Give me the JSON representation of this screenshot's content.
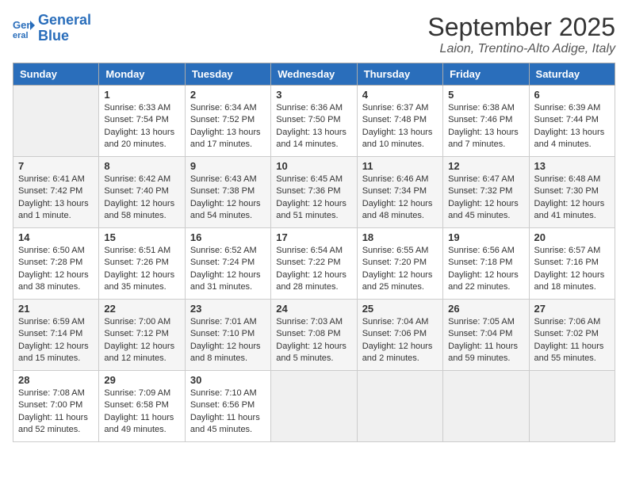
{
  "header": {
    "logo_line1": "General",
    "logo_line2": "Blue",
    "title": "September 2025",
    "subtitle": "Laion, Trentino-Alto Adige, Italy"
  },
  "days_of_week": [
    "Sunday",
    "Monday",
    "Tuesday",
    "Wednesday",
    "Thursday",
    "Friday",
    "Saturday"
  ],
  "weeks": [
    [
      {
        "day": "",
        "sunrise": "",
        "sunset": "",
        "daylight": "",
        "empty": true
      },
      {
        "day": "1",
        "sunrise": "Sunrise: 6:33 AM",
        "sunset": "Sunset: 7:54 PM",
        "daylight": "Daylight: 13 hours and 20 minutes."
      },
      {
        "day": "2",
        "sunrise": "Sunrise: 6:34 AM",
        "sunset": "Sunset: 7:52 PM",
        "daylight": "Daylight: 13 hours and 17 minutes."
      },
      {
        "day": "3",
        "sunrise": "Sunrise: 6:36 AM",
        "sunset": "Sunset: 7:50 PM",
        "daylight": "Daylight: 13 hours and 14 minutes."
      },
      {
        "day": "4",
        "sunrise": "Sunrise: 6:37 AM",
        "sunset": "Sunset: 7:48 PM",
        "daylight": "Daylight: 13 hours and 10 minutes."
      },
      {
        "day": "5",
        "sunrise": "Sunrise: 6:38 AM",
        "sunset": "Sunset: 7:46 PM",
        "daylight": "Daylight: 13 hours and 7 minutes."
      },
      {
        "day": "6",
        "sunrise": "Sunrise: 6:39 AM",
        "sunset": "Sunset: 7:44 PM",
        "daylight": "Daylight: 13 hours and 4 minutes."
      }
    ],
    [
      {
        "day": "7",
        "sunrise": "Sunrise: 6:41 AM",
        "sunset": "Sunset: 7:42 PM",
        "daylight": "Daylight: 13 hours and 1 minute."
      },
      {
        "day": "8",
        "sunrise": "Sunrise: 6:42 AM",
        "sunset": "Sunset: 7:40 PM",
        "daylight": "Daylight: 12 hours and 58 minutes."
      },
      {
        "day": "9",
        "sunrise": "Sunrise: 6:43 AM",
        "sunset": "Sunset: 7:38 PM",
        "daylight": "Daylight: 12 hours and 54 minutes."
      },
      {
        "day": "10",
        "sunrise": "Sunrise: 6:45 AM",
        "sunset": "Sunset: 7:36 PM",
        "daylight": "Daylight: 12 hours and 51 minutes."
      },
      {
        "day": "11",
        "sunrise": "Sunrise: 6:46 AM",
        "sunset": "Sunset: 7:34 PM",
        "daylight": "Daylight: 12 hours and 48 minutes."
      },
      {
        "day": "12",
        "sunrise": "Sunrise: 6:47 AM",
        "sunset": "Sunset: 7:32 PM",
        "daylight": "Daylight: 12 hours and 45 minutes."
      },
      {
        "day": "13",
        "sunrise": "Sunrise: 6:48 AM",
        "sunset": "Sunset: 7:30 PM",
        "daylight": "Daylight: 12 hours and 41 minutes."
      }
    ],
    [
      {
        "day": "14",
        "sunrise": "Sunrise: 6:50 AM",
        "sunset": "Sunset: 7:28 PM",
        "daylight": "Daylight: 12 hours and 38 minutes."
      },
      {
        "day": "15",
        "sunrise": "Sunrise: 6:51 AM",
        "sunset": "Sunset: 7:26 PM",
        "daylight": "Daylight: 12 hours and 35 minutes."
      },
      {
        "day": "16",
        "sunrise": "Sunrise: 6:52 AM",
        "sunset": "Sunset: 7:24 PM",
        "daylight": "Daylight: 12 hours and 31 minutes."
      },
      {
        "day": "17",
        "sunrise": "Sunrise: 6:54 AM",
        "sunset": "Sunset: 7:22 PM",
        "daylight": "Daylight: 12 hours and 28 minutes."
      },
      {
        "day": "18",
        "sunrise": "Sunrise: 6:55 AM",
        "sunset": "Sunset: 7:20 PM",
        "daylight": "Daylight: 12 hours and 25 minutes."
      },
      {
        "day": "19",
        "sunrise": "Sunrise: 6:56 AM",
        "sunset": "Sunset: 7:18 PM",
        "daylight": "Daylight: 12 hours and 22 minutes."
      },
      {
        "day": "20",
        "sunrise": "Sunrise: 6:57 AM",
        "sunset": "Sunset: 7:16 PM",
        "daylight": "Daylight: 12 hours and 18 minutes."
      }
    ],
    [
      {
        "day": "21",
        "sunrise": "Sunrise: 6:59 AM",
        "sunset": "Sunset: 7:14 PM",
        "daylight": "Daylight: 12 hours and 15 minutes."
      },
      {
        "day": "22",
        "sunrise": "Sunrise: 7:00 AM",
        "sunset": "Sunset: 7:12 PM",
        "daylight": "Daylight: 12 hours and 12 minutes."
      },
      {
        "day": "23",
        "sunrise": "Sunrise: 7:01 AM",
        "sunset": "Sunset: 7:10 PM",
        "daylight": "Daylight: 12 hours and 8 minutes."
      },
      {
        "day": "24",
        "sunrise": "Sunrise: 7:03 AM",
        "sunset": "Sunset: 7:08 PM",
        "daylight": "Daylight: 12 hours and 5 minutes."
      },
      {
        "day": "25",
        "sunrise": "Sunrise: 7:04 AM",
        "sunset": "Sunset: 7:06 PM",
        "daylight": "Daylight: 12 hours and 2 minutes."
      },
      {
        "day": "26",
        "sunrise": "Sunrise: 7:05 AM",
        "sunset": "Sunset: 7:04 PM",
        "daylight": "Daylight: 11 hours and 59 minutes."
      },
      {
        "day": "27",
        "sunrise": "Sunrise: 7:06 AM",
        "sunset": "Sunset: 7:02 PM",
        "daylight": "Daylight: 11 hours and 55 minutes."
      }
    ],
    [
      {
        "day": "28",
        "sunrise": "Sunrise: 7:08 AM",
        "sunset": "Sunset: 7:00 PM",
        "daylight": "Daylight: 11 hours and 52 minutes."
      },
      {
        "day": "29",
        "sunrise": "Sunrise: 7:09 AM",
        "sunset": "Sunset: 6:58 PM",
        "daylight": "Daylight: 11 hours and 49 minutes."
      },
      {
        "day": "30",
        "sunrise": "Sunrise: 7:10 AM",
        "sunset": "Sunset: 6:56 PM",
        "daylight": "Daylight: 11 hours and 45 minutes."
      },
      {
        "day": "",
        "sunrise": "",
        "sunset": "",
        "daylight": "",
        "empty": true
      },
      {
        "day": "",
        "sunrise": "",
        "sunset": "",
        "daylight": "",
        "empty": true
      },
      {
        "day": "",
        "sunrise": "",
        "sunset": "",
        "daylight": "",
        "empty": true
      },
      {
        "day": "",
        "sunrise": "",
        "sunset": "",
        "daylight": "",
        "empty": true
      }
    ]
  ]
}
